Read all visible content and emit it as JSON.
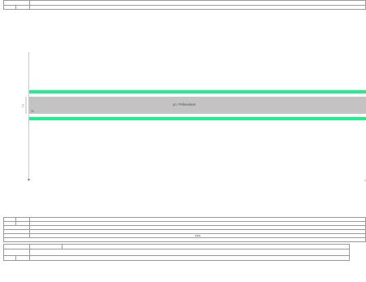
{
  "drawing": {
    "street_name": "ул. Рябиновая",
    "road_width": "7.0",
    "sidewalk_note": "2ф",
    "scale_label": "100м"
  },
  "colors": {
    "road": "#c3c3c3",
    "green_band": "#1ef08c",
    "axis": "#a8a8a8",
    "marker": "#e0302a"
  }
}
